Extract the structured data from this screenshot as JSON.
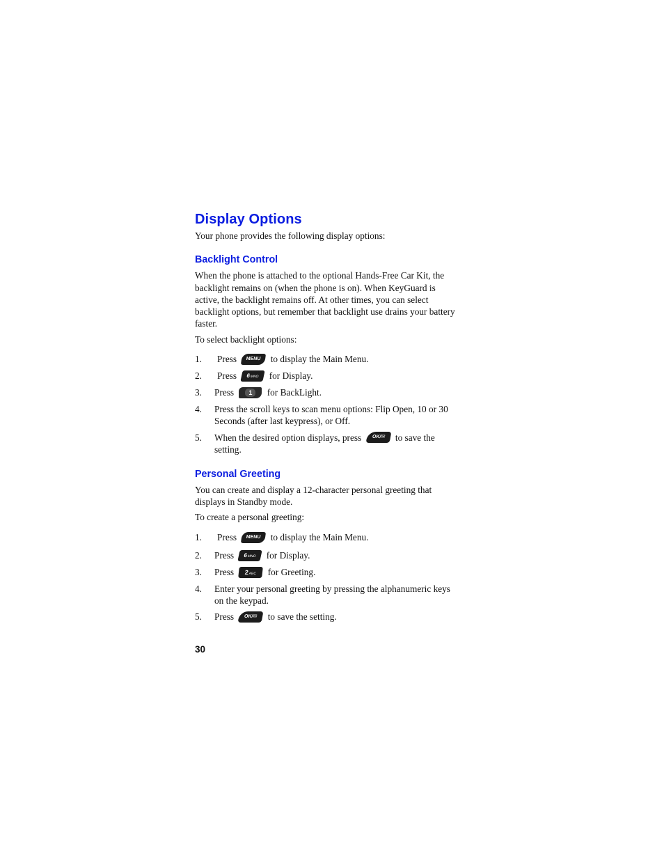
{
  "title": "Display Options",
  "intro": "Your phone provides the following display options:",
  "sections": [
    {
      "heading": "Backlight Control",
      "paragraph": "When the phone is attached to the optional Hands-Free Car Kit, the backlight remains on (when the phone is on). When KeyGuard is active, the backlight remains off. At other times, you can select backlight options, but remember that backlight use drains your battery faster.",
      "lead": "To select backlight options:",
      "steps": [
        {
          "num": "1.",
          "before": "Press",
          "key": "MENU",
          "after": "to display the Main Menu."
        },
        {
          "num": "2.",
          "before": "Press",
          "key": "6",
          "key_sub": "MNO",
          "after": "for Display."
        },
        {
          "num": "3.",
          "before": "Press",
          "key": "1",
          "after": "for BackLight."
        },
        {
          "num": "4.",
          "text": "Press the scroll keys to scan menu options: Flip Open, 10 or 30 Seconds (after last keypress), or Off."
        },
        {
          "num": "5.",
          "before": "When the desired option displays, press",
          "key": "OK/✉",
          "after": "to save the setting."
        }
      ]
    },
    {
      "heading": "Personal Greeting",
      "paragraph": "You can create and display a 12-character personal greeting that displays in Standby mode.",
      "lead": "To create a personal greeting:",
      "steps": [
        {
          "num": "1.",
          "before": "Press",
          "key": "MENU",
          "after": "to display the Main Menu."
        },
        {
          "num": "2.",
          "before": "Press",
          "key": "6",
          "key_sub": "MNO",
          "after": "for Display."
        },
        {
          "num": "3.",
          "before": "Press",
          "key": "2",
          "key_sub": "ABC",
          "after": "for Greeting."
        },
        {
          "num": "4.",
          "text": "Enter your personal greeting by pressing the alphanumeric keys on the keypad."
        },
        {
          "num": "5.",
          "before": "Press",
          "key": "OK/✉",
          "after": "to save the setting."
        }
      ]
    }
  ],
  "page_number": "30",
  "colors": {
    "heading": "#0b1de0",
    "text": "#111111",
    "key": "#1c1c1c"
  }
}
